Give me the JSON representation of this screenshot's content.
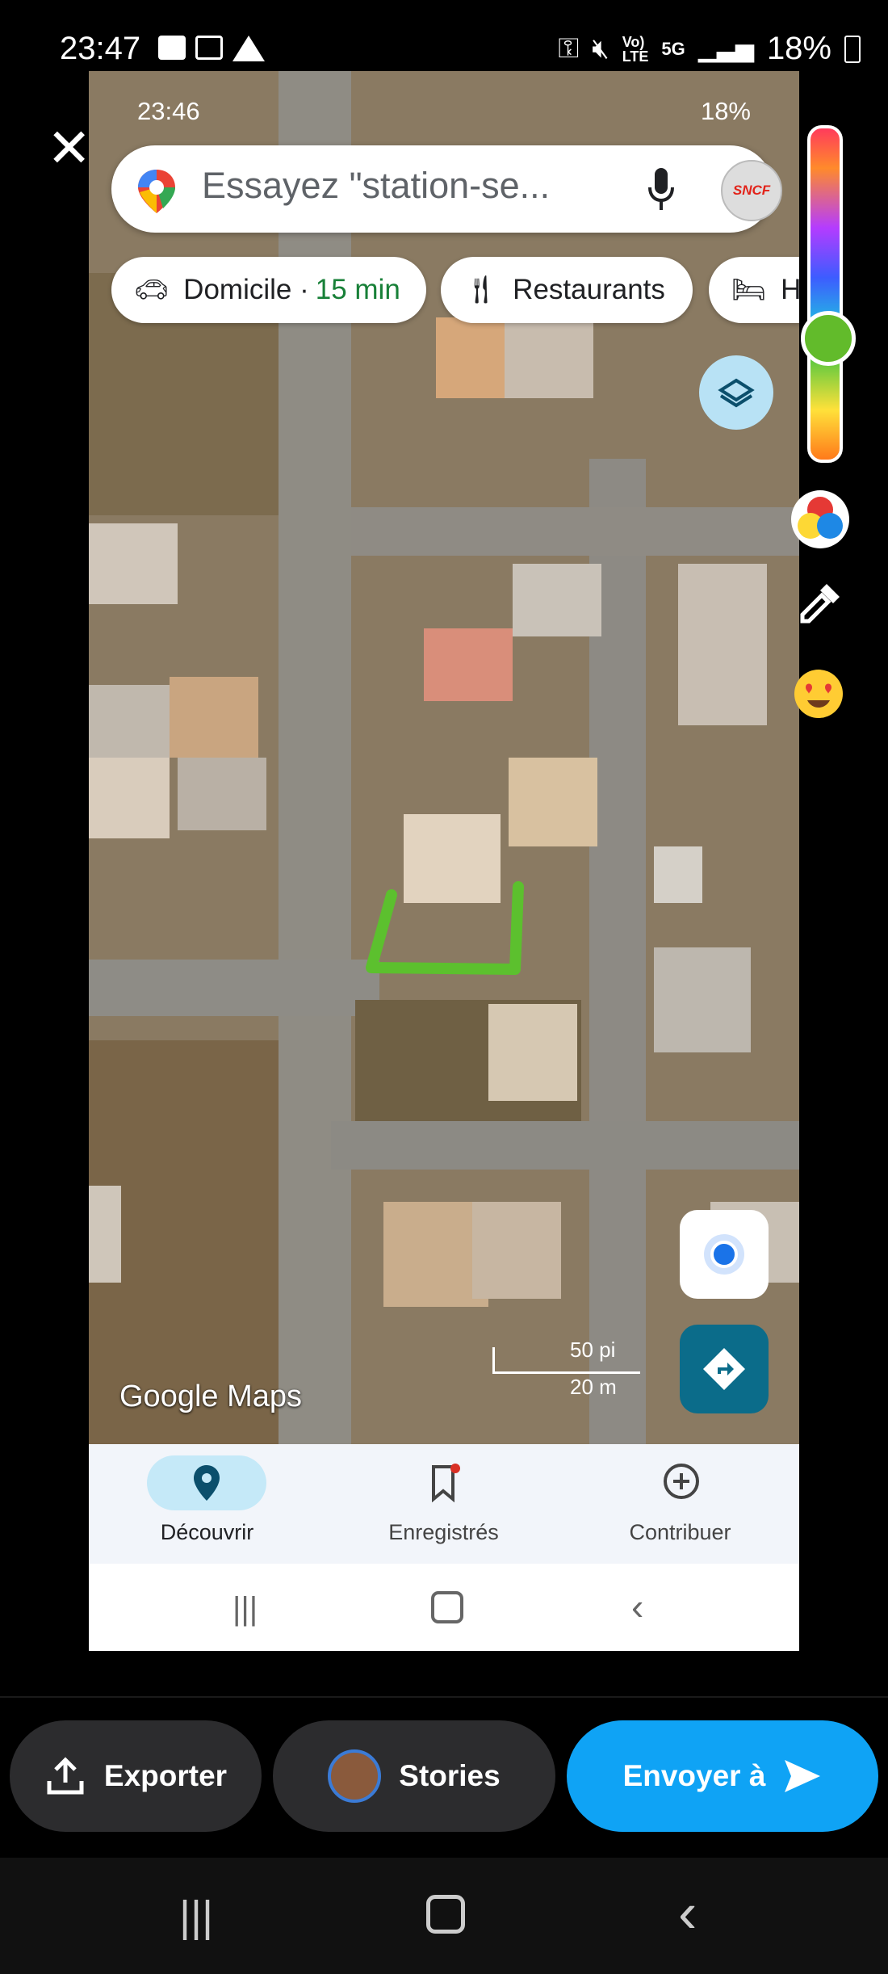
{
  "status_bar": {
    "time": "23:47",
    "battery": "18%",
    "network": "5G"
  },
  "inner_status_bar": {
    "time": "23:46",
    "battery": "18%"
  },
  "search": {
    "placeholder": "Essayez \"station-se...",
    "avatar_text": "SNCF"
  },
  "chips": [
    {
      "label": "Domicile · ",
      "extra": "15 min"
    },
    {
      "label": "Restaurants"
    },
    {
      "label": "Hô"
    }
  ],
  "map": {
    "brand": "Google Maps",
    "scale_ft": "50 pi",
    "scale_m": "20 m"
  },
  "bottom_nav": [
    {
      "label": "Découvrir",
      "active": true
    },
    {
      "label": "Enregistrés",
      "active": false
    },
    {
      "label": "Contribuer",
      "active": false
    }
  ],
  "actions": {
    "export": "Exporter",
    "stories": "Stories",
    "send": "Envoyer à"
  },
  "colors": {
    "accent": "#0fa3f5",
    "dark_button": "#2c2c2e",
    "map_teal": "#0b6c8a",
    "highlight": "#62bb2b"
  }
}
